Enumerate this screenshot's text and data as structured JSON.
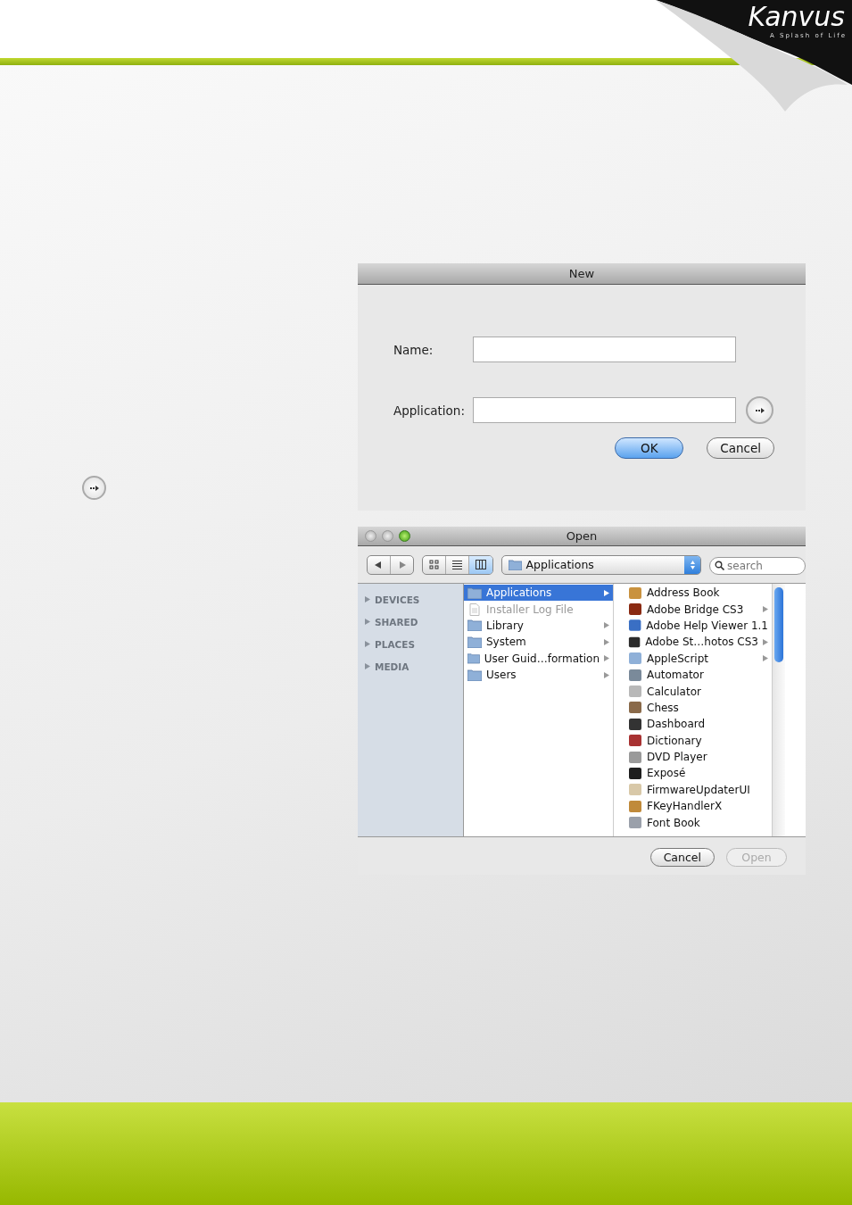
{
  "logo": {
    "name": "Kanvus",
    "tagline": "A Splash of Life"
  },
  "new_dialog": {
    "title": "New",
    "fields": [
      {
        "label": "Name:",
        "browse": false
      },
      {
        "label": "Application:",
        "browse": true
      }
    ],
    "buttons": [
      {
        "label": "OK",
        "default": true
      },
      {
        "label": "Cancel",
        "default": false
      }
    ]
  },
  "open_dialog": {
    "title": "Open",
    "view_modes": [
      {
        "kind": "icons",
        "selected": false
      },
      {
        "kind": "list",
        "selected": false
      },
      {
        "kind": "columns",
        "selected": true
      }
    ],
    "location": "Applications",
    "search": {
      "placeholder": "search"
    },
    "sidebar": [
      {
        "label": "DEVICES",
        "expanded": false
      },
      {
        "label": "SHARED",
        "expanded": false
      },
      {
        "label": "PLACES",
        "expanded": false
      },
      {
        "label": "MEDIA",
        "expanded": false
      }
    ],
    "column_1": [
      {
        "label": "Applications",
        "kind": "folder",
        "selected": true,
        "disabled": false,
        "has_children": true
      },
      {
        "label": "Installer Log File",
        "kind": "file",
        "selected": false,
        "disabled": true,
        "has_children": false
      },
      {
        "label": "Library",
        "kind": "folder",
        "selected": false,
        "disabled": false,
        "has_children": true
      },
      {
        "label": "System",
        "kind": "folder",
        "selected": false,
        "disabled": false,
        "has_children": true
      },
      {
        "label": "User Guid…formation",
        "kind": "folder",
        "selected": false,
        "disabled": false,
        "has_children": true
      },
      {
        "label": "Users",
        "kind": "folder",
        "selected": false,
        "disabled": false,
        "has_children": true
      }
    ],
    "column_2": [
      {
        "label": "Address Book",
        "has_children": false
      },
      {
        "label": "Adobe Bridge CS3",
        "has_children": true
      },
      {
        "label": "Adobe Help Viewer 1.1",
        "has_children": false
      },
      {
        "label": "Adobe St…hotos CS3",
        "has_children": true
      },
      {
        "label": "AppleScript",
        "has_children": true
      },
      {
        "label": "Automator",
        "has_children": false
      },
      {
        "label": "Calculator",
        "has_children": false
      },
      {
        "label": "Chess",
        "has_children": false
      },
      {
        "label": "Dashboard",
        "has_children": false
      },
      {
        "label": "Dictionary",
        "has_children": false
      },
      {
        "label": "DVD Player",
        "has_children": false
      },
      {
        "label": "Exposé",
        "has_children": false
      },
      {
        "label": "FirmwareUpdaterUI",
        "has_children": false
      },
      {
        "label": "FKeyHandlerX",
        "has_children": false
      },
      {
        "label": "Font Book",
        "has_children": false
      }
    ],
    "buttons": [
      {
        "label": "Cancel",
        "disabled": false
      },
      {
        "label": "Open",
        "disabled": true
      }
    ]
  }
}
